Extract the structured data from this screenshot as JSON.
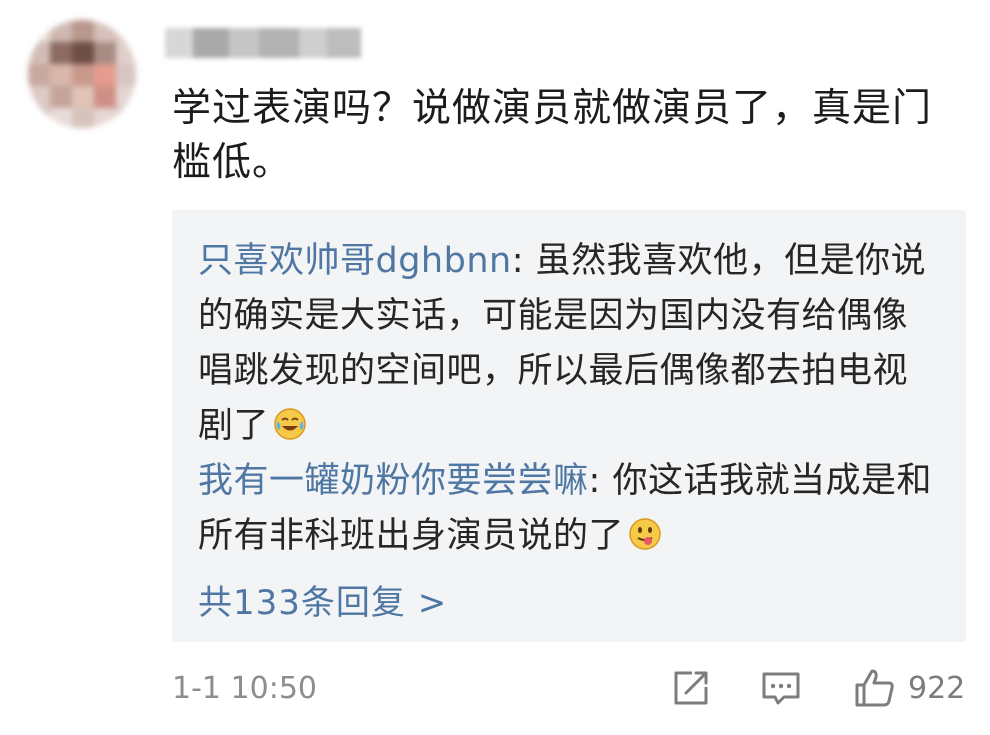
{
  "comment": {
    "username": "",
    "text": "学过表演吗？说做演员就做演员了，真是门槛低。",
    "timestamp": "1-1 10:50",
    "like_count": "922"
  },
  "replies": [
    {
      "author": "只喜欢帅哥dghbnn",
      "separator": ": ",
      "text": "虽然我喜欢他，但是你说的确实是大实话，可能是因为国内没有给偶像唱跳发现的空间吧，所以最后偶像都去拍电视剧了",
      "emoji": "laugh-cry-emoji"
    },
    {
      "author": "我有一罐奶粉你要尝尝嘛",
      "separator": ": ",
      "text": "你这话我就当成是和所有非科班出身演员说的了",
      "emoji": "tongue-emoji"
    }
  ],
  "more_replies_label": "共133条回复 >",
  "colors": {
    "link": "#4f77a3",
    "reply_bg": "#f3f4f6",
    "meta": "#8d8d8d"
  },
  "icons": [
    "share-icon",
    "reply-icon",
    "like-icon"
  ]
}
